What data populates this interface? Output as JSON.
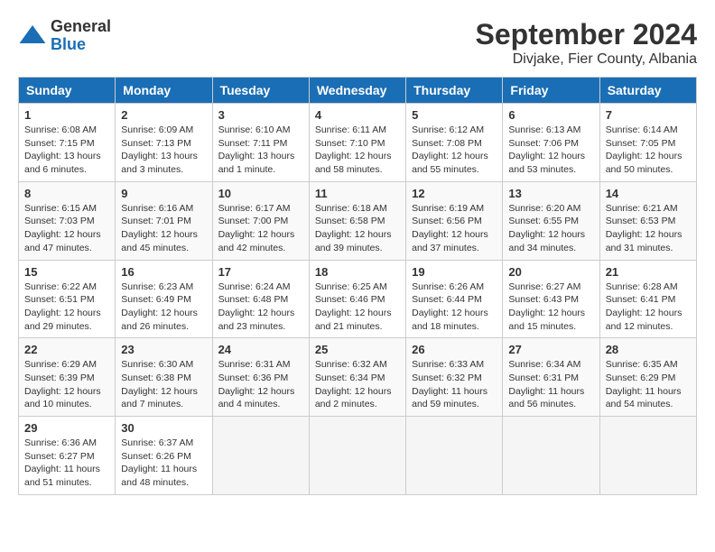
{
  "header": {
    "logo_general": "General",
    "logo_blue": "Blue",
    "month_title": "September 2024",
    "location": "Divjake, Fier County, Albania"
  },
  "calendar": {
    "columns": [
      "Sunday",
      "Monday",
      "Tuesday",
      "Wednesday",
      "Thursday",
      "Friday",
      "Saturday"
    ],
    "weeks": [
      [
        {
          "day": "1",
          "info": "Sunrise: 6:08 AM\nSunset: 7:15 PM\nDaylight: 13 hours\nand 6 minutes."
        },
        {
          "day": "2",
          "info": "Sunrise: 6:09 AM\nSunset: 7:13 PM\nDaylight: 13 hours\nand 3 minutes."
        },
        {
          "day": "3",
          "info": "Sunrise: 6:10 AM\nSunset: 7:11 PM\nDaylight: 13 hours\nand 1 minute."
        },
        {
          "day": "4",
          "info": "Sunrise: 6:11 AM\nSunset: 7:10 PM\nDaylight: 12 hours\nand 58 minutes."
        },
        {
          "day": "5",
          "info": "Sunrise: 6:12 AM\nSunset: 7:08 PM\nDaylight: 12 hours\nand 55 minutes."
        },
        {
          "day": "6",
          "info": "Sunrise: 6:13 AM\nSunset: 7:06 PM\nDaylight: 12 hours\nand 53 minutes."
        },
        {
          "day": "7",
          "info": "Sunrise: 6:14 AM\nSunset: 7:05 PM\nDaylight: 12 hours\nand 50 minutes."
        }
      ],
      [
        {
          "day": "8",
          "info": "Sunrise: 6:15 AM\nSunset: 7:03 PM\nDaylight: 12 hours\nand 47 minutes."
        },
        {
          "day": "9",
          "info": "Sunrise: 6:16 AM\nSunset: 7:01 PM\nDaylight: 12 hours\nand 45 minutes."
        },
        {
          "day": "10",
          "info": "Sunrise: 6:17 AM\nSunset: 7:00 PM\nDaylight: 12 hours\nand 42 minutes."
        },
        {
          "day": "11",
          "info": "Sunrise: 6:18 AM\nSunset: 6:58 PM\nDaylight: 12 hours\nand 39 minutes."
        },
        {
          "day": "12",
          "info": "Sunrise: 6:19 AM\nSunset: 6:56 PM\nDaylight: 12 hours\nand 37 minutes."
        },
        {
          "day": "13",
          "info": "Sunrise: 6:20 AM\nSunset: 6:55 PM\nDaylight: 12 hours\nand 34 minutes."
        },
        {
          "day": "14",
          "info": "Sunrise: 6:21 AM\nSunset: 6:53 PM\nDaylight: 12 hours\nand 31 minutes."
        }
      ],
      [
        {
          "day": "15",
          "info": "Sunrise: 6:22 AM\nSunset: 6:51 PM\nDaylight: 12 hours\nand 29 minutes."
        },
        {
          "day": "16",
          "info": "Sunrise: 6:23 AM\nSunset: 6:49 PM\nDaylight: 12 hours\nand 26 minutes."
        },
        {
          "day": "17",
          "info": "Sunrise: 6:24 AM\nSunset: 6:48 PM\nDaylight: 12 hours\nand 23 minutes."
        },
        {
          "day": "18",
          "info": "Sunrise: 6:25 AM\nSunset: 6:46 PM\nDaylight: 12 hours\nand 21 minutes."
        },
        {
          "day": "19",
          "info": "Sunrise: 6:26 AM\nSunset: 6:44 PM\nDaylight: 12 hours\nand 18 minutes."
        },
        {
          "day": "20",
          "info": "Sunrise: 6:27 AM\nSunset: 6:43 PM\nDaylight: 12 hours\nand 15 minutes."
        },
        {
          "day": "21",
          "info": "Sunrise: 6:28 AM\nSunset: 6:41 PM\nDaylight: 12 hours\nand 12 minutes."
        }
      ],
      [
        {
          "day": "22",
          "info": "Sunrise: 6:29 AM\nSunset: 6:39 PM\nDaylight: 12 hours\nand 10 minutes."
        },
        {
          "day": "23",
          "info": "Sunrise: 6:30 AM\nSunset: 6:38 PM\nDaylight: 12 hours\nand 7 minutes."
        },
        {
          "day": "24",
          "info": "Sunrise: 6:31 AM\nSunset: 6:36 PM\nDaylight: 12 hours\nand 4 minutes."
        },
        {
          "day": "25",
          "info": "Sunrise: 6:32 AM\nSunset: 6:34 PM\nDaylight: 12 hours\nand 2 minutes."
        },
        {
          "day": "26",
          "info": "Sunrise: 6:33 AM\nSunset: 6:32 PM\nDaylight: 11 hours\nand 59 minutes."
        },
        {
          "day": "27",
          "info": "Sunrise: 6:34 AM\nSunset: 6:31 PM\nDaylight: 11 hours\nand 56 minutes."
        },
        {
          "day": "28",
          "info": "Sunrise: 6:35 AM\nSunset: 6:29 PM\nDaylight: 11 hours\nand 54 minutes."
        }
      ],
      [
        {
          "day": "29",
          "info": "Sunrise: 6:36 AM\nSunset: 6:27 PM\nDaylight: 11 hours\nand 51 minutes."
        },
        {
          "day": "30",
          "info": "Sunrise: 6:37 AM\nSunset: 6:26 PM\nDaylight: 11 hours\nand 48 minutes."
        },
        {
          "day": "",
          "info": ""
        },
        {
          "day": "",
          "info": ""
        },
        {
          "day": "",
          "info": ""
        },
        {
          "day": "",
          "info": ""
        },
        {
          "day": "",
          "info": ""
        }
      ]
    ]
  }
}
